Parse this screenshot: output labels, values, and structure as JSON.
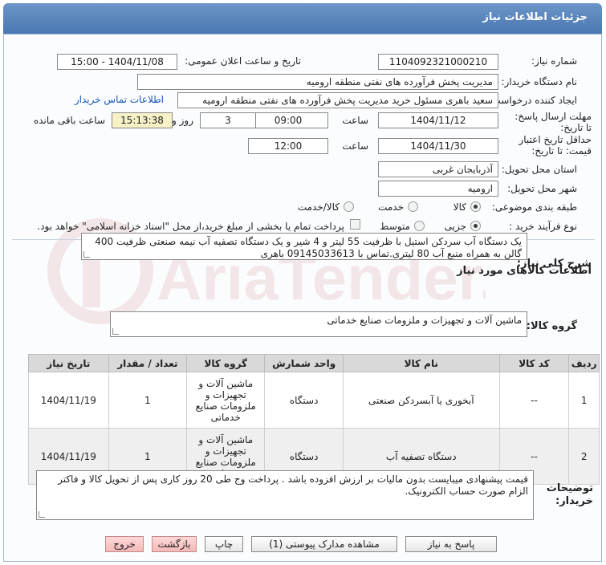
{
  "header": {
    "title": "جزئیات اطلاعات نیاز"
  },
  "form": {
    "need_number_label": "شماره نیاز:",
    "need_number": "1104092321000210",
    "announce_label": "تاریخ و ساعت اعلان عمومی:",
    "announce_value": "1404/11/08 - 15:00",
    "buyer_org_label": "نام دستگاه خریدار:",
    "buyer_org": "مدیریت پخش فرآورده های نفتی منطقه ارومیه",
    "requester_label": "ایجاد کننده درخواست:",
    "requester": "سعید باهری مسئول خرید مدیریت پخش فرآورده های نفتی منطقه ارومیه",
    "contact_link": "اطلاعات تماس خریدار",
    "reply_deadline_label": "مهلت ارسال پاسخ: تا تاریخ:",
    "reply_date": "1404/11/12",
    "time_label": "ساعت",
    "reply_time": "09:00",
    "days_value": "3",
    "days_label": "روز و",
    "remaining_time": "15:13:38",
    "remaining_label": "ساعت باقی مانده",
    "validity_label": "حداقل تاریخ اعتبار قیمت: تا تاریخ:",
    "validity_date": "1404/11/30",
    "validity_time": "12:00",
    "province_label": "استان محل تحویل:",
    "province": "آذربایجان غربی",
    "city_label": "شهر محل تحویل:",
    "city": "ارومیه",
    "category_label": "طبقه بندی موضوعی:",
    "category_options": [
      "کالا",
      "خدمت",
      "کالا/خدمت"
    ],
    "process_label": "نوع فرآیند خرید :",
    "process_options": [
      "جزیی",
      "متوسط"
    ],
    "process_note": "پرداخت تمام یا بخشی از مبلغ خرید،از محل \"اسناد خزانه اسلامی\" خواهد بود."
  },
  "summary": {
    "label": "شرح کلی نیاز:",
    "text": "یک دستگاه آب سردکن استیل با ظرفیت 55 لیتر و 4 شیر و یک دستگاه تصفیه آب نیمه صنعتی ظرفیت 400 گالن به همراه منبع آب  80 لیتری.تماس با 09145033613 باهری"
  },
  "goods_info": {
    "title": "اطلاعات کالاهای مورد نیاز",
    "group_label": "گروه کالا:",
    "group_value": "ماشین آلات و تجهیزات و ملزومات صنایع خدماتی"
  },
  "table": {
    "headers": [
      "ردیف",
      "کد کالا",
      "نام کالا",
      "واحد شمارش",
      "گروه کالا",
      "تعداد / مقدار",
      "تاریخ نیاز"
    ],
    "rows": [
      [
        "1",
        "--",
        "آبخوری یا آبسردکن صنعتی",
        "دستگاه",
        "ماشین آلات و تجهیزات و ملزومات صنایع خدماتی",
        "1",
        "1404/11/19"
      ],
      [
        "2",
        "--",
        "دستگاه تصفیه آب",
        "دستگاه",
        "ماشین آلات و تجهیزات و ملزومات صنایع خدماتی",
        "1",
        "1404/11/19"
      ]
    ]
  },
  "notes": {
    "label": "توضیحات خریدار:",
    "text": "قیمت پیشنهادی میبایست بدون مالیات بر ارزش افزوده باشد . پرداخت وج طی 20 روز کاری پس از تحویل کالا و فاکتر الزام صورت حساب الکترونیک."
  },
  "buttons": {
    "reply": "پاسخ به نیاز",
    "attachments": "مشاهده مدارک پیوستی (1)",
    "print": "چاپ",
    "back": "بازگشت",
    "exit": "خروج"
  },
  "watermark": {
    "text": "AriaTender.net"
  }
}
